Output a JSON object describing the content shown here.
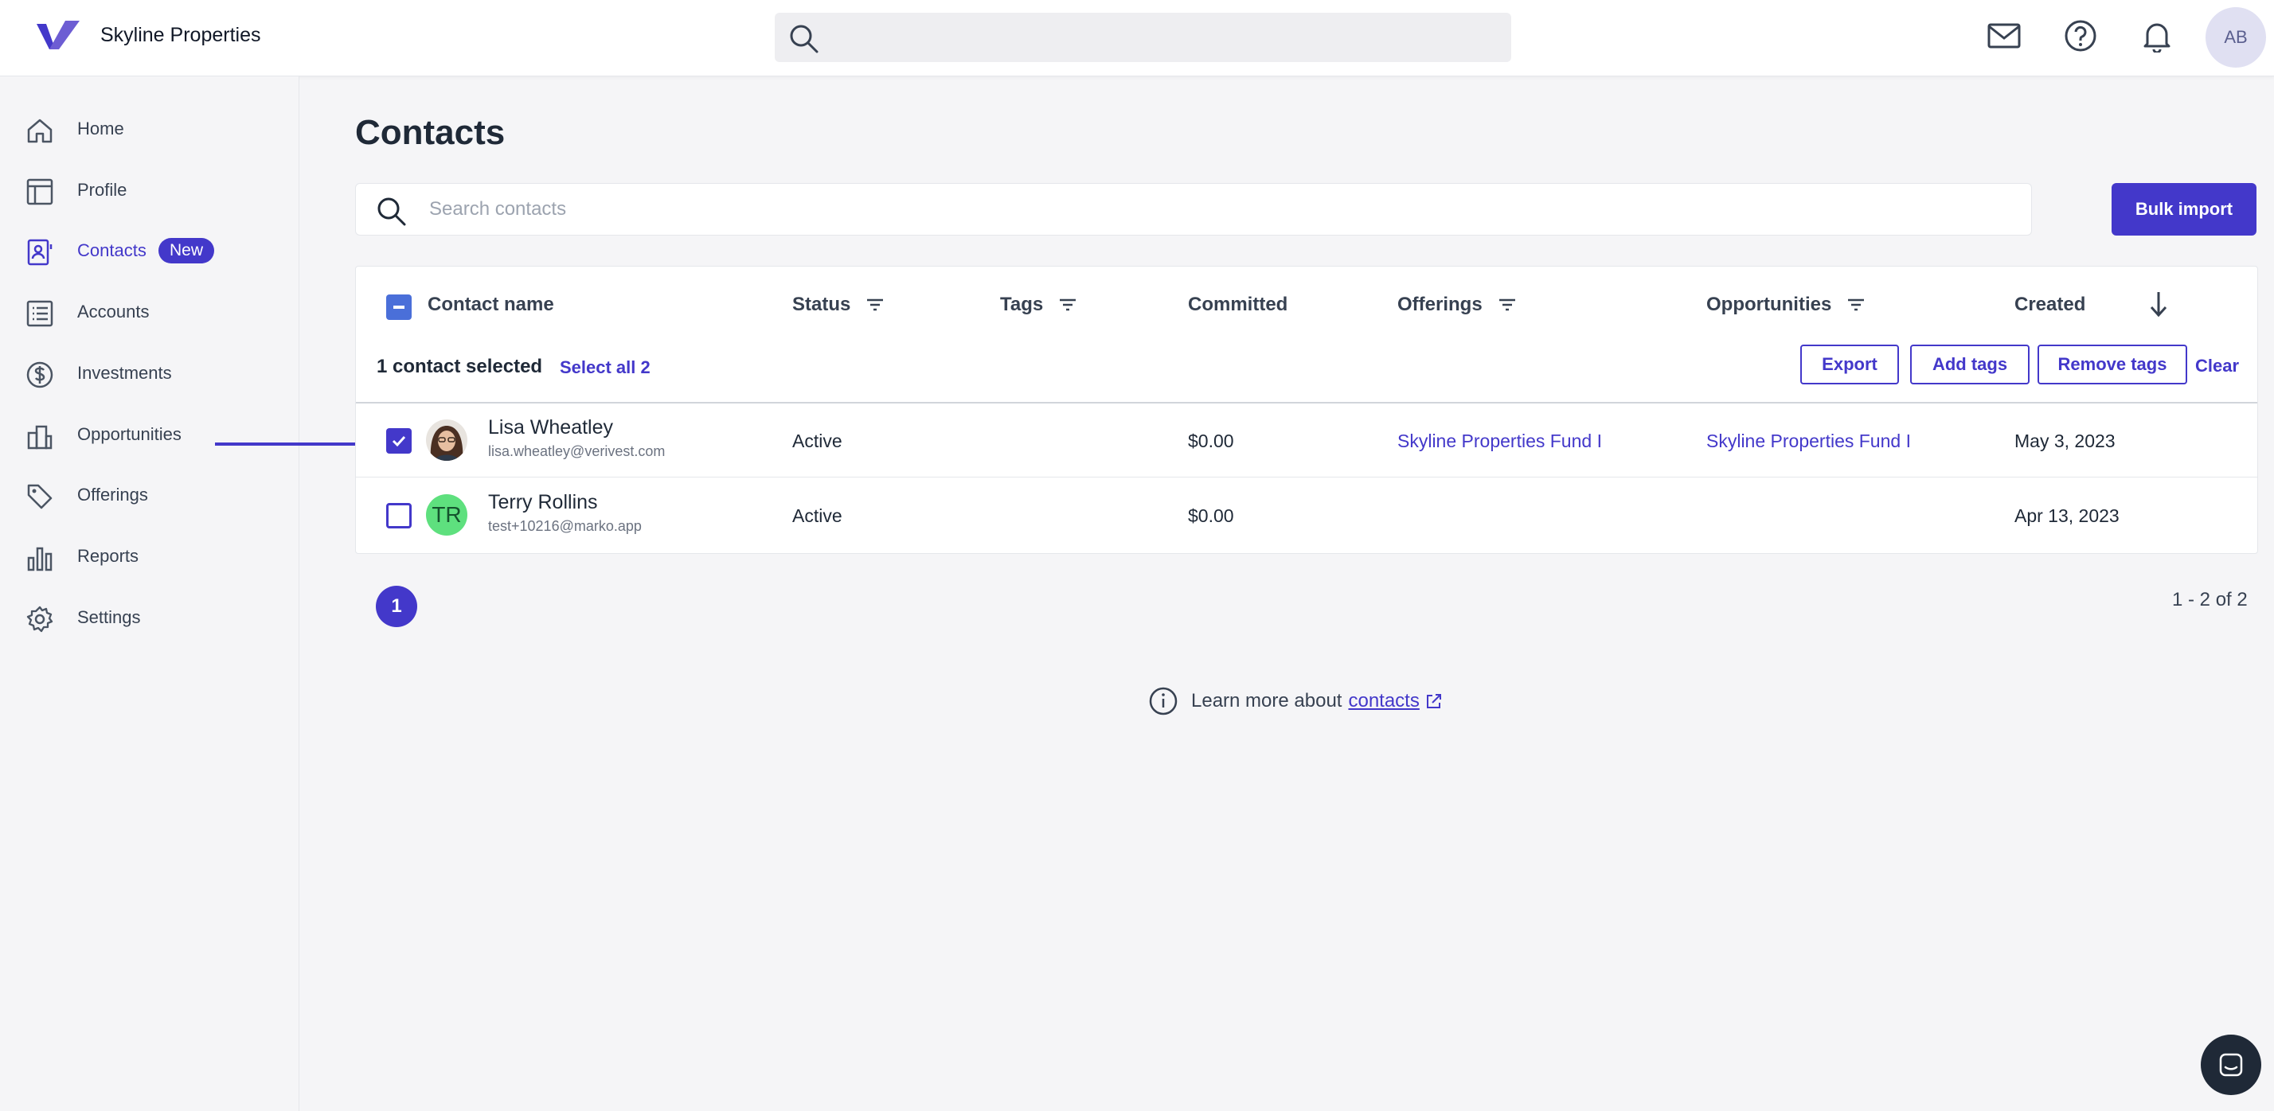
{
  "app": {
    "name": "Skyline Properties",
    "user_initials": "AB"
  },
  "colors": {
    "accent": "#4338ca",
    "indeterminate": "#4a6fd9",
    "avatar_green": "#5ee07e"
  },
  "topbar": {
    "search_placeholder": "",
    "icons": [
      "mail-icon",
      "help-icon",
      "bell-icon"
    ]
  },
  "sidebar": {
    "items": [
      {
        "label": "Home",
        "icon": "home-icon"
      },
      {
        "label": "Profile",
        "icon": "profile-icon"
      },
      {
        "label": "Contacts",
        "icon": "contacts-icon",
        "badge": "New",
        "active": true
      },
      {
        "label": "Accounts",
        "icon": "accounts-icon"
      },
      {
        "label": "Investments",
        "icon": "investments-icon"
      },
      {
        "label": "Opportunities",
        "icon": "opportunities-icon"
      },
      {
        "label": "Offerings",
        "icon": "offerings-icon"
      },
      {
        "label": "Reports",
        "icon": "reports-icon"
      },
      {
        "label": "Settings",
        "icon": "settings-icon"
      }
    ]
  },
  "main": {
    "title": "Contacts",
    "search_placeholder": "Search contacts",
    "bulk_import_label": "Bulk import",
    "table": {
      "columns": [
        "Contact name",
        "Status",
        "Tags",
        "Committed",
        "Offerings",
        "Opportunities",
        "Created"
      ],
      "selection": {
        "text": "1 contact selected",
        "select_all": "Select all 2",
        "actions": [
          "Export",
          "Add tags",
          "Remove tags"
        ],
        "clear": "Clear"
      },
      "rows": [
        {
          "name": "Lisa Wheatley",
          "email": "lisa.wheatley@verivest.com",
          "status": "Active",
          "tags": "",
          "committed": "$0.00",
          "offerings": "Skyline Properties Fund I",
          "opportunities": "Skyline Properties Fund I",
          "created": "May 3, 2023",
          "checked": true,
          "avatar_initials": ""
        },
        {
          "name": "Terry Rollins",
          "email": "test+10216@marko.app",
          "status": "Active",
          "tags": "",
          "committed": "$0.00",
          "offerings": "",
          "opportunities": "",
          "created": "Apr 13, 2023",
          "checked": false,
          "avatar_initials": "TR"
        }
      ]
    },
    "pagination": {
      "current_page": "1",
      "range": "1 - 2 of 2"
    },
    "footer": {
      "learn_more": "Learn more about",
      "link": "contacts"
    }
  }
}
